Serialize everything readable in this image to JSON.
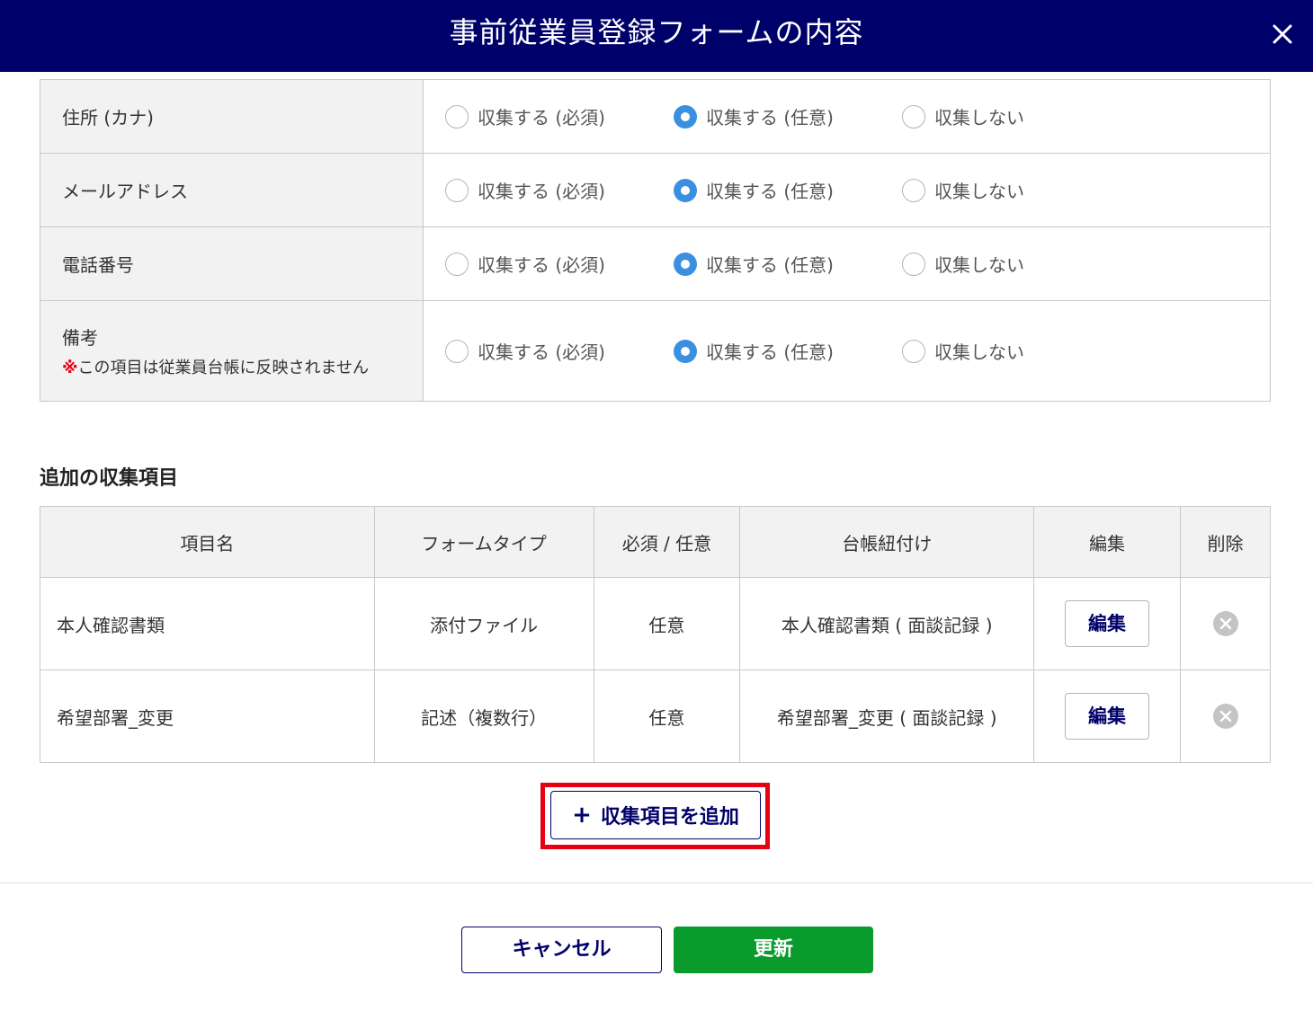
{
  "dialog": {
    "title": "事前従業員登録フォームの内容"
  },
  "basic_fields": {
    "option_labels": [
      "収集する (必須)",
      "収集する (任意)",
      "収集しない"
    ],
    "rows": [
      {
        "label": "住所 (カナ)",
        "selected": 1
      },
      {
        "label": "メールアドレス",
        "selected": 1
      },
      {
        "label": "電話番号",
        "selected": 1
      },
      {
        "label": "備考",
        "note_mark": "※",
        "note": "この項目は従業員台帳に反映されません",
        "selected": 1
      }
    ]
  },
  "additional": {
    "heading": "追加の収集項目",
    "columns": [
      "項目名",
      "フォームタイプ",
      "必須 / 任意",
      "台帳紐付け",
      "編集",
      "削除"
    ],
    "rows": [
      {
        "name": "本人確認書類",
        "form_type": "添付ファイル",
        "required": "任意",
        "ledger": "本人確認書類 ( 面談記録 )",
        "edit_label": "編集"
      },
      {
        "name": "希望部署_変更",
        "form_type": "記述（複数行）",
        "required": "任意",
        "ledger": "希望部署_変更 ( 面談記録 )",
        "edit_label": "編集"
      }
    ],
    "add_button": {
      "icon": "plus-icon",
      "label": "収集項目を追加"
    }
  },
  "footer": {
    "cancel_label": "キャンセル",
    "update_label": "更新"
  },
  "colors": {
    "header_bg": "#00006a",
    "radio_checked": "#3b8fe0",
    "update_button": "#0a9b2d",
    "highlight": "#e60012"
  }
}
